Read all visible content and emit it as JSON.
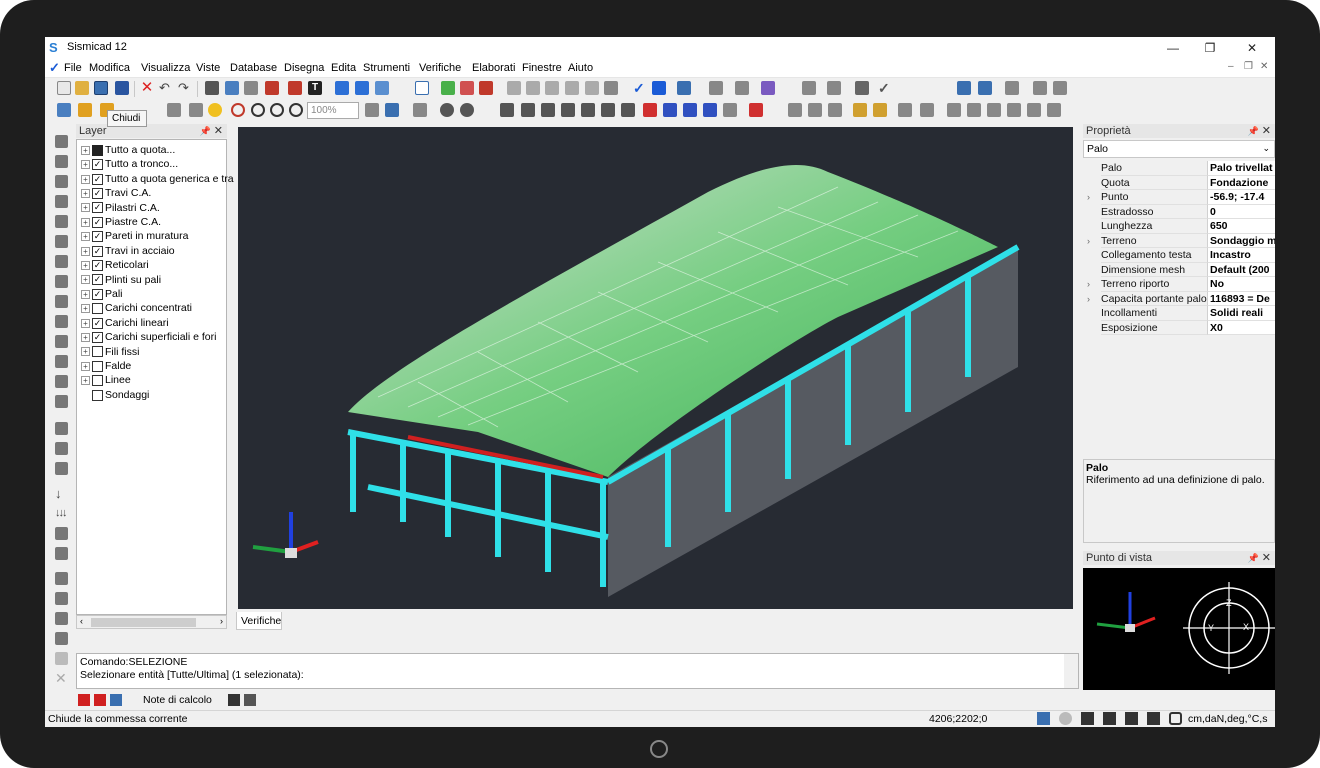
{
  "window": {
    "title": "Sismicad 12",
    "minimize": "—",
    "restore": "❐",
    "close": "✕"
  },
  "menu": [
    "File",
    "Modifica",
    "Visualizza",
    "Viste",
    "Database",
    "Disegna",
    "Edita",
    "Strumenti",
    "Verifiche",
    "Elaborati",
    "Finestre",
    "Aiuto"
  ],
  "toolbar": {
    "zoom_value": "100%",
    "tooltip": "Chiudi"
  },
  "layer_panel": {
    "title": "Layer",
    "items": [
      {
        "label": "Tutto a quota...",
        "check": "square"
      },
      {
        "label": "Tutto a tronco...",
        "check": "on"
      },
      {
        "label": "Tutto a quota generica e tra",
        "check": "on"
      },
      {
        "label": "Travi C.A.",
        "check": "on"
      },
      {
        "label": "Pilastri C.A.",
        "check": "on"
      },
      {
        "label": "Piastre C.A.",
        "check": "on"
      },
      {
        "label": "Pareti in muratura",
        "check": "on"
      },
      {
        "label": "Travi in acciaio",
        "check": "on"
      },
      {
        "label": "Reticolari",
        "check": "on"
      },
      {
        "label": "Plinti su pali",
        "check": "on"
      },
      {
        "label": "Pali",
        "check": "on"
      },
      {
        "label": "Carichi concentrati",
        "check": "off"
      },
      {
        "label": "Carichi lineari",
        "check": "on"
      },
      {
        "label": "Carichi superficiali e fori",
        "check": "on"
      },
      {
        "label": "Fili fissi",
        "check": "off"
      },
      {
        "label": "Falde",
        "check": "off"
      },
      {
        "label": "Linee",
        "check": "off"
      },
      {
        "label": "Sondaggi",
        "check": "off"
      }
    ]
  },
  "viewport": {
    "tab": "Verifiche"
  },
  "command": {
    "line1": "Comando:SELEZIONE",
    "line2": "Selezionare entità [Tutte/Ultima] (1 selezionata):"
  },
  "bottom_tabs": {
    "notes": "Note di calcolo"
  },
  "status": {
    "message": "Chiude la commessa corrente",
    "coords": "4206;2202;0",
    "units": "cm,daN,deg,°C,s"
  },
  "properties": {
    "title": "Proprietà",
    "selected": "Palo",
    "rows": [
      {
        "key": "Palo",
        "value": "Palo trivellat",
        "expand": false
      },
      {
        "key": "Quota",
        "value": "Fondazione",
        "expand": false
      },
      {
        "key": "Punto",
        "value": "-56.9; -17.4",
        "expand": true
      },
      {
        "key": "Estradosso",
        "value": "0",
        "expand": false
      },
      {
        "key": "Lunghezza",
        "value": "650",
        "expand": false
      },
      {
        "key": "Terreno",
        "value": "Sondaggio m",
        "expand": true
      },
      {
        "key": "Collegamento testa",
        "value": "Incastro",
        "expand": false
      },
      {
        "key": "Dimensione mesh",
        "value": "Default (200",
        "expand": false
      },
      {
        "key": "Terreno riporto",
        "value": "No",
        "expand": true
      },
      {
        "key": "Capacita portante palo",
        "value": "116893 = De",
        "expand": true
      },
      {
        "key": "Incollamenti",
        "value": "Solidi reali",
        "expand": false
      },
      {
        "key": "Esposizione",
        "value": "X0",
        "expand": false
      }
    ],
    "desc_title": "Palo",
    "desc_text": "Riferimento ad una definizione di palo."
  },
  "point_of_view": {
    "title": "Punto di vista",
    "axis_z": "Z",
    "axis_y": "Y",
    "axis_x": "X"
  },
  "colors": {
    "structure_cyan": "#2fe0e8",
    "roof_green": "#7ee08a",
    "beam_red": "#d02020",
    "viewport_bg": "#272b33"
  }
}
